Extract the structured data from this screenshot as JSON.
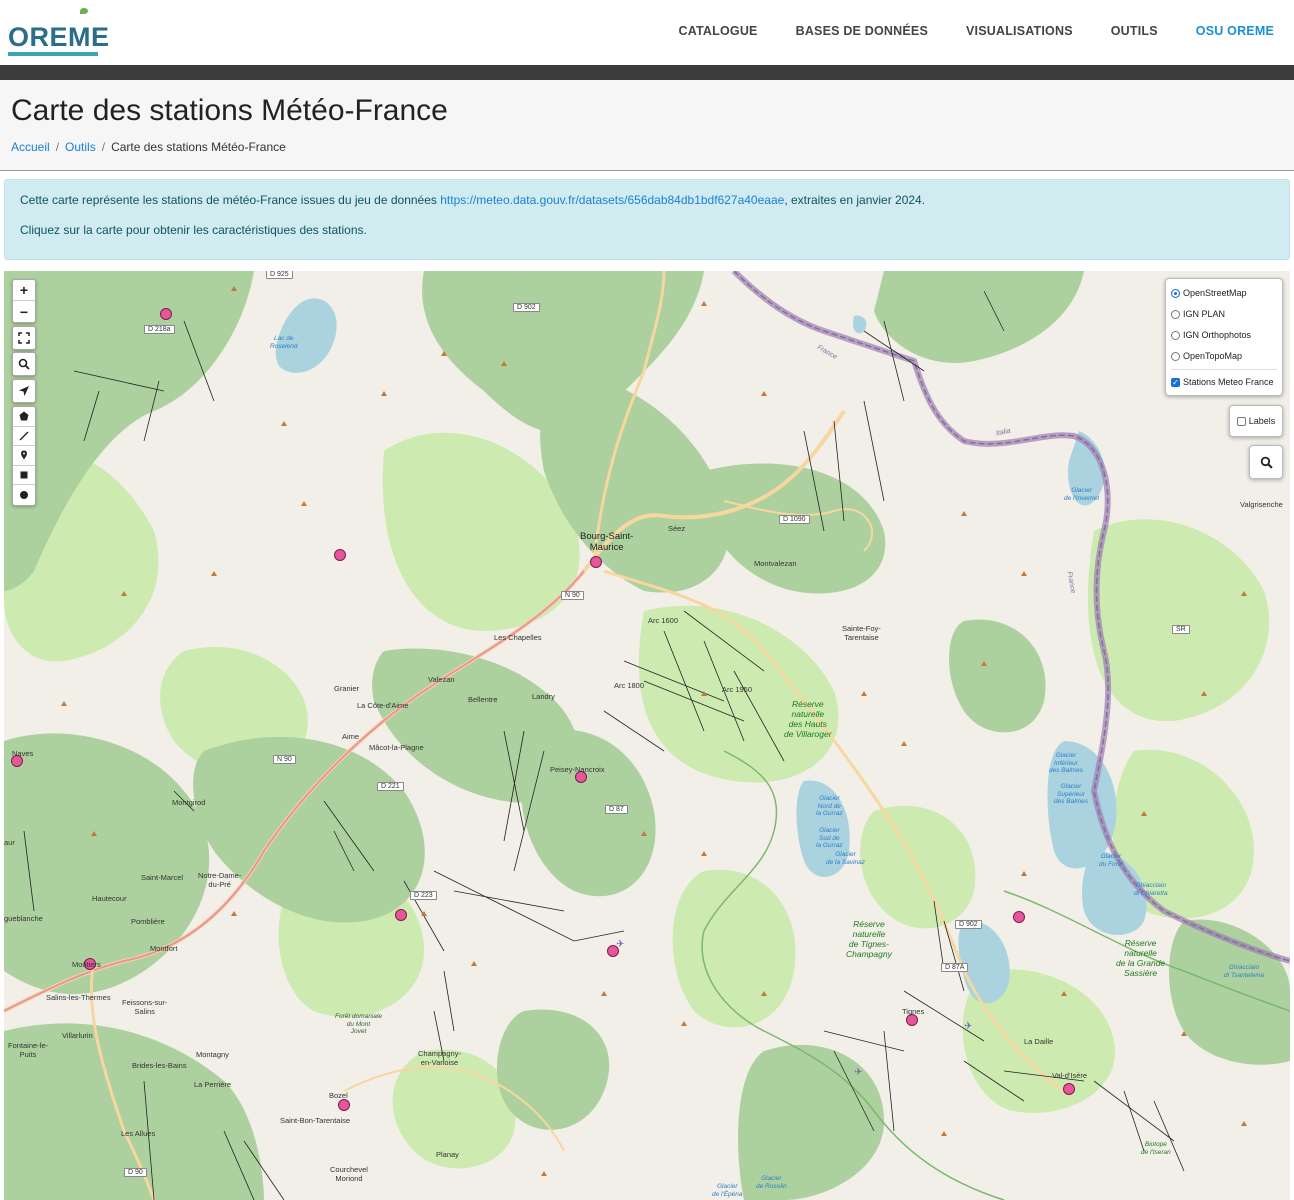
{
  "header": {
    "logo_text": "OREME",
    "nav": [
      "CATALOGUE",
      "BASES DE DONNÉES",
      "VISUALISATIONS",
      "OUTILS",
      "OSU OREME"
    ]
  },
  "page": {
    "title": "Carte des stations Météo-France",
    "breadcrumb": [
      "Accueil",
      "Outils",
      "Carte des stations Météo-France"
    ],
    "breadcrumb_sep": "/"
  },
  "info": {
    "line1_pre": "Cette carte représente les stations de météo-France issues du jeu de données ",
    "line1_link": "https://meteo.data.gouv.fr/datasets/656dab84db1bdf627a40eaae",
    "line1_post": ", extraites en janvier 2024.",
    "line2": "Cliquez sur la carte pour obtenir les caractéristiques des stations."
  },
  "map": {
    "zoom_in": "+",
    "zoom_out": "−",
    "layers": {
      "base": [
        "OpenStreetMap",
        "IGN PLAN",
        "IGN Orthophotos",
        "OpenTopoMap"
      ],
      "selected": "OpenStreetMap",
      "overlay": "Stations Meteo France",
      "overlay_checked": true
    },
    "labels_toggle": "Labels",
    "labels_checked": false,
    "colors": {
      "station": "#e5569a",
      "border": "#9b7fb0",
      "forest": "#add19e",
      "meadow": "#cdebb0",
      "water": "#aad3df"
    },
    "icons": [
      "fullscreen-icon",
      "search-icon",
      "locate-icon",
      "polygon-icon",
      "polyline-icon",
      "marker-icon",
      "rectangle-icon",
      "circle-icon"
    ],
    "places": {
      "bourg": "Bourg-Saint-\nMaurice",
      "seez": "Séez",
      "montvalezan": "Montvalezan",
      "sainte_foy": "Sainte-Foy-\nTarentaise",
      "valgrisenche": "Valgrisenche",
      "les_chapelles": "Les Chapelles",
      "arc1600": "Arc 1600",
      "arc1800": "Arc 1800",
      "arc1950": "Arc 1950",
      "valezan": "Valezan",
      "bellentre": "Bellentre",
      "landry": "Landry",
      "granier": "Granier",
      "la_cote_daime": "La Côte-d'Aime",
      "aime": "Aime",
      "macot": "Mâcot-la-Plagne",
      "naves": "Naves",
      "peisey": "Peisey-Nancroix",
      "montgirod": "Montgirod",
      "saint_marcel": "Saint-Marcel",
      "notre_dame": "Notre-Dame-\ndu-Pré",
      "hautecour": "Hautecour",
      "pomblière": "Pomblière",
      "aigueblanche": "gueblanche",
      "montfort": "Montfort",
      "moutiers": "Moûtiers",
      "salins": "Salins-les-Thermes",
      "feissons": "Feissons-sur-\nSalins",
      "villarlurin": "Villarlurin",
      "fontaine": "Fontaine-le-\nPuits",
      "brides": "Brides-les-Bains",
      "montagny": "Montagny",
      "la_perriere": "La Perrière",
      "les_allues": "Les Allues",
      "bozel": "Bozel",
      "saint_bon": "Saint-Bon-Tarentaise",
      "courchevel": "Courchevel\nMoriond",
      "planay": "Planay",
      "champagny": "Champagny-\nen-Vanoise",
      "tignes": "Tignes",
      "la_daille": "La Daille",
      "val_disere": "Val-d'Isère",
      "aur": "aur"
    },
    "roads": [
      "D 925",
      "D 218a",
      "D 902",
      "D 1090",
      "N 90",
      "N 90",
      "D 221",
      "D 87",
      "D 223",
      "D 902",
      "D 87A",
      "D 90",
      "SR"
    ],
    "reserves": [
      "Réserve\nnaturelle\ndes Hauts\nde Villaroger",
      "Réserve\nnaturelle\nde Tignes-\nChampagny",
      "Réserve\nnaturelle\nde la Grande\nSassière"
    ],
    "glaciers": [
      "Glacier\nde l'Invernet",
      "Glacier\nInférieur\ndes Balmes",
      "Glacier\nSupérieur\ndes Balmes",
      "Glacier\ndu Fond",
      "Ghiacciaio\ndi Ghiaretta",
      "Ghiacciaio\ndi Tsanteleina",
      "Glacier\nNord de\nla Gurraz",
      "Glacier\nSud de\nla Gurraz",
      "Glacier\nde la Savinaz",
      "Glacier\nde Rosolin",
      "Glacier\nde l'Épéna",
      "Biotope\nde l'Iseran",
      "Lac de\nRoselend",
      "Forêt domaniale\ndu Mont\nJovet"
    ],
    "borders": [
      "France",
      "Italia",
      "France"
    ]
  }
}
